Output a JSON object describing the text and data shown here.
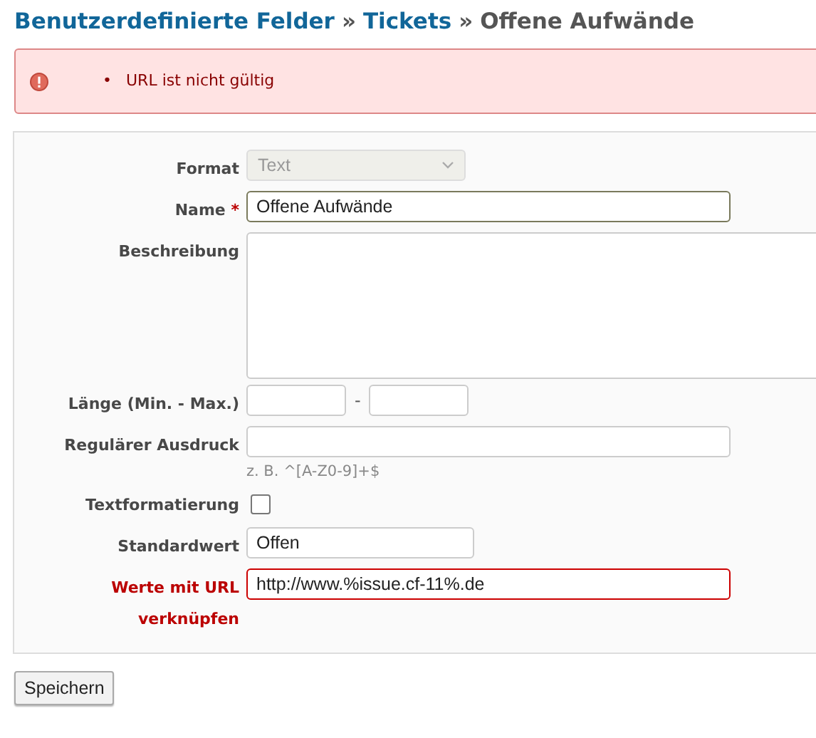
{
  "title": {
    "links": [
      "Benutzerdefinierte Felder",
      "Tickets"
    ],
    "separators": [
      "»",
      "»"
    ],
    "current": "Offene Aufwände"
  },
  "errors": [
    {
      "bullet": "•",
      "text": "URL ist nicht gültig"
    }
  ],
  "fields": [
    {
      "kind": "select",
      "label": "Format",
      "value": "Text",
      "disabled": true,
      "error": false
    },
    {
      "kind": "text",
      "label": "Name",
      "value": "Offene Aufwände",
      "required_mark": "*",
      "error": false,
      "focused": true
    },
    {
      "kind": "textarea",
      "label": "Beschreibung",
      "error": false
    },
    {
      "kind": "range",
      "label": "Länge (Min. - Max.)",
      "separator": "-",
      "error": false
    },
    {
      "kind": "text",
      "label": "Regulärer Ausdruck",
      "hint": "z. B. ^[A-Z0-9]+$",
      "error": false,
      "focused": false
    },
    {
      "kind": "checkbox",
      "label": "Textformatierung",
      "checked": false,
      "error": false
    },
    {
      "kind": "short_text",
      "label": "Standardwert",
      "value": "Offen",
      "error": false,
      "focused": false
    },
    {
      "kind": "text",
      "label": "Werte mit URL verknüpfen",
      "value": "http://www.%issue.cf-11%.de",
      "error": true,
      "focused": false
    }
  ],
  "buttons": [
    "Speichern"
  ]
}
